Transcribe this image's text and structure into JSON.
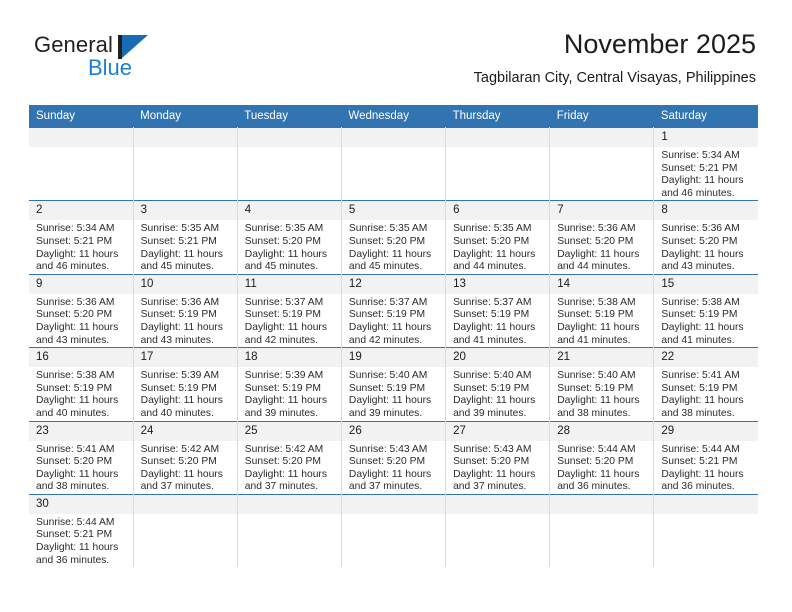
{
  "brand": {
    "name_part1": "General",
    "name_part2": "Blue",
    "colors": {
      "dark": "#231f20",
      "blue": "#1a7fd4",
      "header_blue": "#3274b2"
    }
  },
  "header": {
    "month_title": "November 2025",
    "location": "Tagbilaran City, Central Visayas, Philippines"
  },
  "weekday_headers": [
    "Sunday",
    "Monday",
    "Tuesday",
    "Wednesday",
    "Thursday",
    "Friday",
    "Saturday"
  ],
  "labels": {
    "sunrise": "Sunrise:",
    "sunset": "Sunset:",
    "daylight": "Daylight:"
  },
  "weeks": [
    [
      {
        "day": "",
        "blank": true
      },
      {
        "day": "",
        "blank": true
      },
      {
        "day": "",
        "blank": true
      },
      {
        "day": "",
        "blank": true
      },
      {
        "day": "",
        "blank": true
      },
      {
        "day": "",
        "blank": true
      },
      {
        "day": "1",
        "sunrise": "Sunrise: 5:34 AM",
        "sunset": "Sunset: 5:21 PM",
        "daylight1": "Daylight: 11 hours",
        "daylight2": "and 46 minutes."
      }
    ],
    [
      {
        "day": "2",
        "sunrise": "Sunrise: 5:34 AM",
        "sunset": "Sunset: 5:21 PM",
        "daylight1": "Daylight: 11 hours",
        "daylight2": "and 46 minutes."
      },
      {
        "day": "3",
        "sunrise": "Sunrise: 5:35 AM",
        "sunset": "Sunset: 5:21 PM",
        "daylight1": "Daylight: 11 hours",
        "daylight2": "and 45 minutes."
      },
      {
        "day": "4",
        "sunrise": "Sunrise: 5:35 AM",
        "sunset": "Sunset: 5:20 PM",
        "daylight1": "Daylight: 11 hours",
        "daylight2": "and 45 minutes."
      },
      {
        "day": "5",
        "sunrise": "Sunrise: 5:35 AM",
        "sunset": "Sunset: 5:20 PM",
        "daylight1": "Daylight: 11 hours",
        "daylight2": "and 45 minutes."
      },
      {
        "day": "6",
        "sunrise": "Sunrise: 5:35 AM",
        "sunset": "Sunset: 5:20 PM",
        "daylight1": "Daylight: 11 hours",
        "daylight2": "and 44 minutes."
      },
      {
        "day": "7",
        "sunrise": "Sunrise: 5:36 AM",
        "sunset": "Sunset: 5:20 PM",
        "daylight1": "Daylight: 11 hours",
        "daylight2": "and 44 minutes."
      },
      {
        "day": "8",
        "sunrise": "Sunrise: 5:36 AM",
        "sunset": "Sunset: 5:20 PM",
        "daylight1": "Daylight: 11 hours",
        "daylight2": "and 43 minutes."
      }
    ],
    [
      {
        "day": "9",
        "sunrise": "Sunrise: 5:36 AM",
        "sunset": "Sunset: 5:20 PM",
        "daylight1": "Daylight: 11 hours",
        "daylight2": "and 43 minutes."
      },
      {
        "day": "10",
        "sunrise": "Sunrise: 5:36 AM",
        "sunset": "Sunset: 5:19 PM",
        "daylight1": "Daylight: 11 hours",
        "daylight2": "and 43 minutes."
      },
      {
        "day": "11",
        "sunrise": "Sunrise: 5:37 AM",
        "sunset": "Sunset: 5:19 PM",
        "daylight1": "Daylight: 11 hours",
        "daylight2": "and 42 minutes."
      },
      {
        "day": "12",
        "sunrise": "Sunrise: 5:37 AM",
        "sunset": "Sunset: 5:19 PM",
        "daylight1": "Daylight: 11 hours",
        "daylight2": "and 42 minutes."
      },
      {
        "day": "13",
        "sunrise": "Sunrise: 5:37 AM",
        "sunset": "Sunset: 5:19 PM",
        "daylight1": "Daylight: 11 hours",
        "daylight2": "and 41 minutes."
      },
      {
        "day": "14",
        "sunrise": "Sunrise: 5:38 AM",
        "sunset": "Sunset: 5:19 PM",
        "daylight1": "Daylight: 11 hours",
        "daylight2": "and 41 minutes."
      },
      {
        "day": "15",
        "sunrise": "Sunrise: 5:38 AM",
        "sunset": "Sunset: 5:19 PM",
        "daylight1": "Daylight: 11 hours",
        "daylight2": "and 41 minutes."
      }
    ],
    [
      {
        "day": "16",
        "sunrise": "Sunrise: 5:38 AM",
        "sunset": "Sunset: 5:19 PM",
        "daylight1": "Daylight: 11 hours",
        "daylight2": "and 40 minutes."
      },
      {
        "day": "17",
        "sunrise": "Sunrise: 5:39 AM",
        "sunset": "Sunset: 5:19 PM",
        "daylight1": "Daylight: 11 hours",
        "daylight2": "and 40 minutes."
      },
      {
        "day": "18",
        "sunrise": "Sunrise: 5:39 AM",
        "sunset": "Sunset: 5:19 PM",
        "daylight1": "Daylight: 11 hours",
        "daylight2": "and 39 minutes."
      },
      {
        "day": "19",
        "sunrise": "Sunrise: 5:40 AM",
        "sunset": "Sunset: 5:19 PM",
        "daylight1": "Daylight: 11 hours",
        "daylight2": "and 39 minutes."
      },
      {
        "day": "20",
        "sunrise": "Sunrise: 5:40 AM",
        "sunset": "Sunset: 5:19 PM",
        "daylight1": "Daylight: 11 hours",
        "daylight2": "and 39 minutes."
      },
      {
        "day": "21",
        "sunrise": "Sunrise: 5:40 AM",
        "sunset": "Sunset: 5:19 PM",
        "daylight1": "Daylight: 11 hours",
        "daylight2": "and 38 minutes."
      },
      {
        "day": "22",
        "sunrise": "Sunrise: 5:41 AM",
        "sunset": "Sunset: 5:19 PM",
        "daylight1": "Daylight: 11 hours",
        "daylight2": "and 38 minutes."
      }
    ],
    [
      {
        "day": "23",
        "sunrise": "Sunrise: 5:41 AM",
        "sunset": "Sunset: 5:20 PM",
        "daylight1": "Daylight: 11 hours",
        "daylight2": "and 38 minutes."
      },
      {
        "day": "24",
        "sunrise": "Sunrise: 5:42 AM",
        "sunset": "Sunset: 5:20 PM",
        "daylight1": "Daylight: 11 hours",
        "daylight2": "and 37 minutes."
      },
      {
        "day": "25",
        "sunrise": "Sunrise: 5:42 AM",
        "sunset": "Sunset: 5:20 PM",
        "daylight1": "Daylight: 11 hours",
        "daylight2": "and 37 minutes."
      },
      {
        "day": "26",
        "sunrise": "Sunrise: 5:43 AM",
        "sunset": "Sunset: 5:20 PM",
        "daylight1": "Daylight: 11 hours",
        "daylight2": "and 37 minutes."
      },
      {
        "day": "27",
        "sunrise": "Sunrise: 5:43 AM",
        "sunset": "Sunset: 5:20 PM",
        "daylight1": "Daylight: 11 hours",
        "daylight2": "and 37 minutes."
      },
      {
        "day": "28",
        "sunrise": "Sunrise: 5:44 AM",
        "sunset": "Sunset: 5:20 PM",
        "daylight1": "Daylight: 11 hours",
        "daylight2": "and 36 minutes."
      },
      {
        "day": "29",
        "sunrise": "Sunrise: 5:44 AM",
        "sunset": "Sunset: 5:21 PM",
        "daylight1": "Daylight: 11 hours",
        "daylight2": "and 36 minutes."
      }
    ],
    [
      {
        "day": "30",
        "sunrise": "Sunrise: 5:44 AM",
        "sunset": "Sunset: 5:21 PM",
        "daylight1": "Daylight: 11 hours",
        "daylight2": "and 36 minutes."
      },
      {
        "day": "",
        "blank": true
      },
      {
        "day": "",
        "blank": true
      },
      {
        "day": "",
        "blank": true
      },
      {
        "day": "",
        "blank": true
      },
      {
        "day": "",
        "blank": true
      },
      {
        "day": "",
        "blank": true
      }
    ]
  ]
}
